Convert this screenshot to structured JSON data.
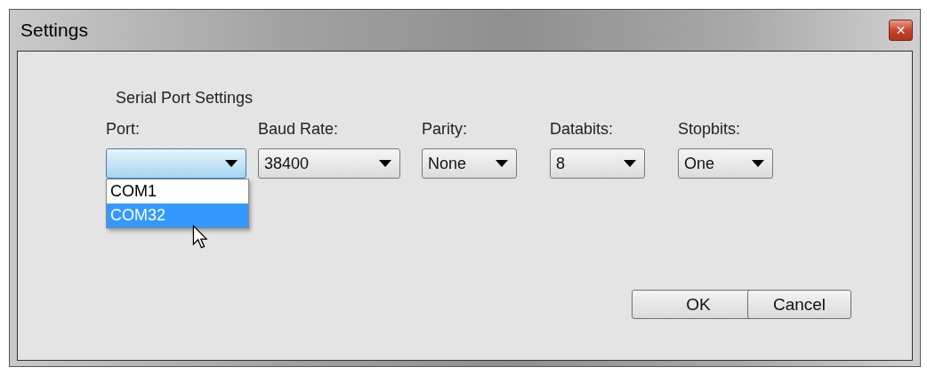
{
  "window": {
    "title": "Settings",
    "close_label": "✕"
  },
  "group": {
    "title": "Serial Port Settings"
  },
  "fields": [
    {
      "label": "Port:",
      "expanded": true,
      "options": [
        {
          "label": "COM1",
          "selected": false
        },
        {
          "label": "COM32",
          "selected": true
        }
      ]
    },
    {
      "label": "Baud Rate:",
      "value": "38400",
      "expanded": false
    },
    {
      "label": "Parity:",
      "value": "None",
      "expanded": false
    },
    {
      "label": "Databits:",
      "value": "8",
      "expanded": false
    },
    {
      "label": "Stopbits:",
      "value": "One",
      "expanded": false
    }
  ],
  "buttons": [
    "OK",
    "Cancel"
  ]
}
